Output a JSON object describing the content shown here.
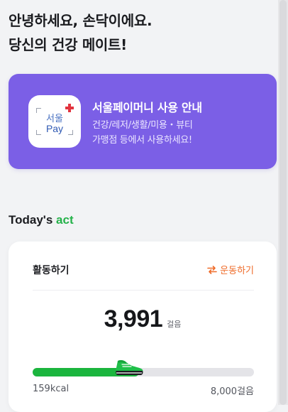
{
  "header": {
    "greeting_line1": "안녕하세요, 손닥이에요.",
    "greeting_line2": "당신의 건강 메이트!"
  },
  "banner": {
    "logo": {
      "line1": "서울",
      "line2": "Pay"
    },
    "title": "서울페이머니 사용 안내",
    "desc_line1": "건강/레저/생활/미용・뷰티",
    "desc_line2": "가맹점 등에서 사용하세요!",
    "bg_color": "#7b5fe6"
  },
  "today": {
    "title_main": "Today's ",
    "title_accent": "act",
    "accent_color": "#25b24a"
  },
  "activity_card": {
    "title": "활동하기",
    "switch_label": "운동하기",
    "switch_icon": "swap-arrows-icon",
    "steps_value": "3,991",
    "steps_unit": "걸음",
    "progress_fraction": 0.48,
    "calories": "159kcal",
    "goal": "8,000걸음",
    "shoe_icon": "sneaker-icon"
  },
  "colors": {
    "progress_fill": "#1bb53e",
    "switch_text": "#ef6b29"
  }
}
